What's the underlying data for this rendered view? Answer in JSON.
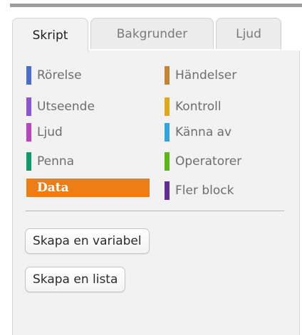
{
  "tabs": [
    {
      "label": "Skript",
      "active": true
    },
    {
      "label": "Bakgrunder",
      "active": false
    },
    {
      "label": "Ljud",
      "active": false
    }
  ],
  "categories": [
    {
      "label": "Rörelse",
      "color": "#4a6cd4"
    },
    {
      "label": "Händelser",
      "color": "#c88330"
    },
    {
      "label": "Utseende",
      "color": "#8a55d7"
    },
    {
      "label": "Kontroll",
      "color": "#e1a91a"
    },
    {
      "label": "Ljud",
      "color": "#bb42c3"
    },
    {
      "label": "Känna av",
      "color": "#2ca5e2"
    },
    {
      "label": "Penna",
      "color": "#0e9a6c"
    },
    {
      "label": "Operatorer",
      "color": "#5cb712"
    },
    {
      "label": "Data",
      "color": "#ee7d16",
      "selected": true
    },
    {
      "label": "Fler block",
      "color": "#632d99"
    }
  ],
  "buttons": {
    "make_variable": "Skapa en variabel",
    "make_list": "Skapa en lista"
  }
}
